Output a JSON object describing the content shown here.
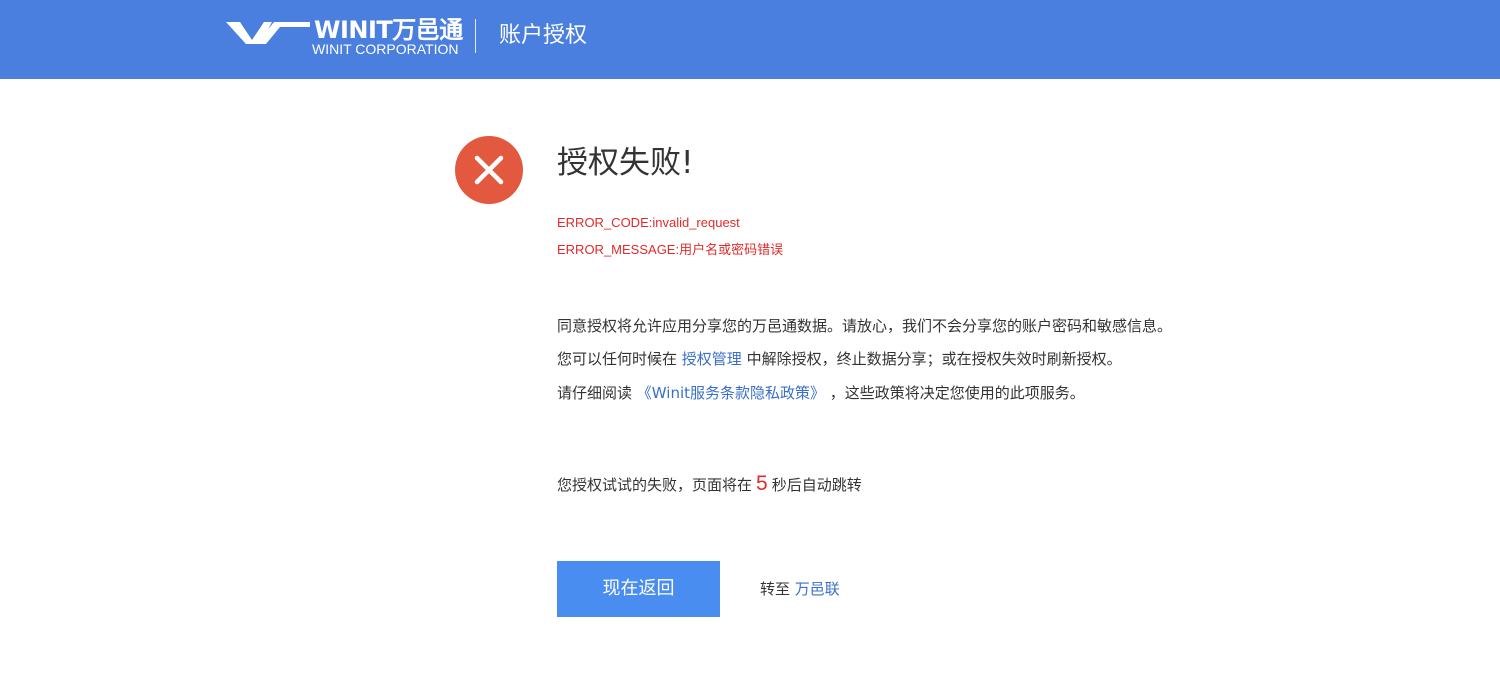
{
  "header": {
    "logo_mark": "WINIT万邑通",
    "logo_sub": "WINIT CORPORATION",
    "title": "账户授权",
    "bg_color": "#4a7fe0"
  },
  "result": {
    "icon": "close-icon",
    "icon_color": "#e3593f",
    "headline": "授权失败!",
    "error_code": "ERROR_CODE:invalid_request",
    "error_message": "ERROR_MESSAGE:用户名或密码错误",
    "error_color": "#e02b2b"
  },
  "info": {
    "line1": "同意授权将允许应用分享您的万邑通数据。请放心，我们不会分享您的账户密码和敏感信息。",
    "line2_pre": "您可以任何时候在 ",
    "line2_link": "授权管理",
    "line2_post": " 中解除授权，终止数据分享；或在授权失效时刷新授权。",
    "line3_pre": "请仔细阅读 ",
    "line3_link": "《Winit服务条款隐私政策》",
    "line3_post": " ，这些政策将决定您使用的此项服务。",
    "link_color": "#3a6fc9"
  },
  "countdown": {
    "pre": "您授权试试的失败，页面将在",
    "seconds": "5",
    "post": "秒后自动跳转"
  },
  "actions": {
    "back_label": "现在返回",
    "goto_label": "转至",
    "goto_link": "万邑联",
    "button_color": "#4a8df0"
  }
}
